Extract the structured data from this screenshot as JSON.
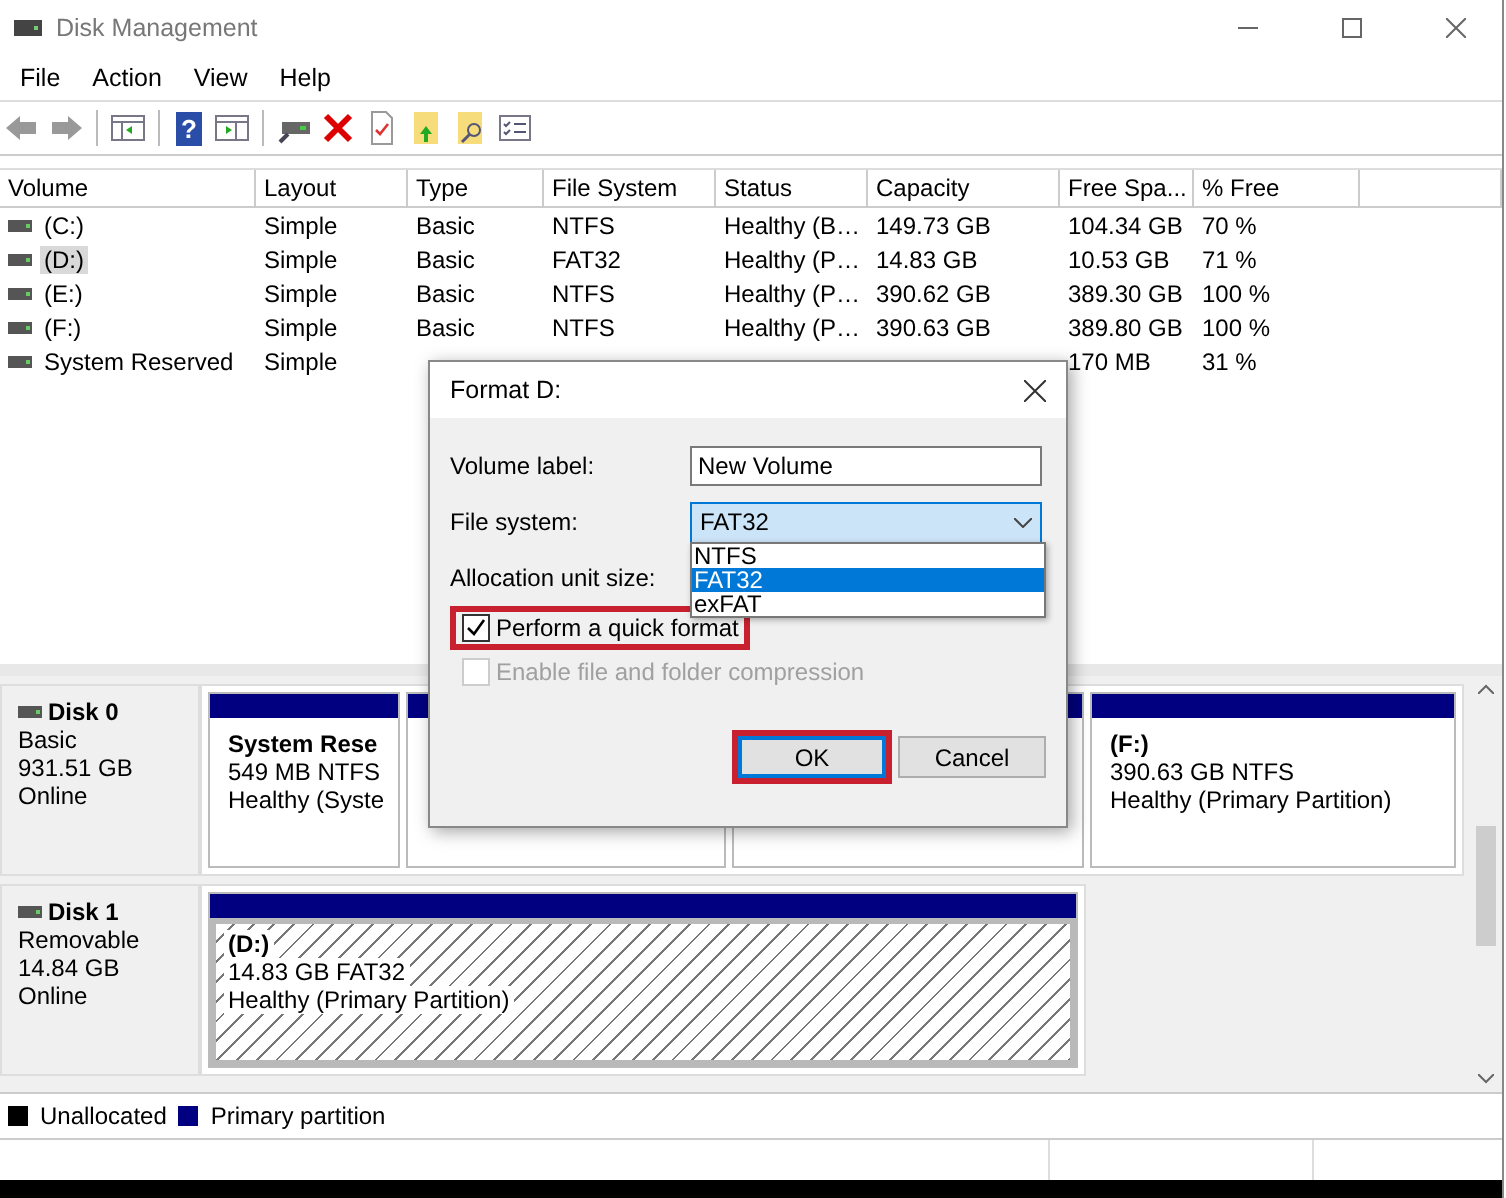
{
  "window": {
    "title": "Disk Management"
  },
  "menu": [
    "File",
    "Action",
    "View",
    "Help"
  ],
  "toolbar": {
    "help_glyph": "?"
  },
  "table": {
    "columns": [
      "Volume",
      "Layout",
      "Type",
      "File System",
      "Status",
      "Capacity",
      "Free Spa...",
      "% Free"
    ],
    "rows": [
      {
        "cells": [
          "(C:)",
          "Simple",
          "Basic",
          "NTFS",
          "Healthy (B…",
          "149.73 GB",
          "104.34 GB",
          "70 %"
        ],
        "selected": false
      },
      {
        "cells": [
          "(D:)",
          "Simple",
          "Basic",
          "FAT32",
          "Healthy (P…",
          "14.83 GB",
          "10.53 GB",
          "71 %"
        ],
        "selected": true
      },
      {
        "cells": [
          "(E:)",
          "Simple",
          "Basic",
          "NTFS",
          "Healthy (P…",
          "390.62 GB",
          "389.30 GB",
          "100 %"
        ],
        "selected": false
      },
      {
        "cells": [
          "(F:)",
          "Simple",
          "Basic",
          "NTFS",
          "Healthy (P…",
          "390.63 GB",
          "389.80 GB",
          "100 %"
        ],
        "selected": false
      },
      {
        "cells": [
          "System Reserved",
          "Simple",
          null,
          null,
          null,
          null,
          "170 MB",
          "31 %"
        ],
        "selected": false
      }
    ]
  },
  "disks": [
    {
      "name": "Disk 0",
      "lines": [
        "Basic",
        "931.51 GB",
        "Online"
      ],
      "partitions": [
        {
          "title": "System Rese",
          "lines": [
            "549 MB NTFS",
            "Healthy (Syste"
          ],
          "hatched": false
        },
        {
          "hatched": false
        },
        {
          "hatched": false
        },
        {
          "title": "(F:)",
          "lines": [
            "390.63 GB NTFS",
            "Healthy (Primary Partition)"
          ],
          "hatched": false
        }
      ]
    },
    {
      "name": "Disk 1",
      "lines": [
        "Removable",
        "14.84 GB",
        "Online"
      ],
      "partitions": [
        {
          "title": "(D:)",
          "lines": [
            "14.83 GB FAT32",
            "Healthy (Primary Partition)"
          ],
          "hatched": true
        }
      ]
    }
  ],
  "legend": [
    {
      "label": "Unallocated",
      "color": "#000000"
    },
    {
      "label": "Primary partition",
      "color": "#000080"
    }
  ],
  "dialog": {
    "title": "Format D:",
    "volume_label": {
      "label": "Volume label:",
      "value": "New Volume"
    },
    "file_system": {
      "label": "File system:",
      "value": "FAT32",
      "options": [
        {
          "label": "NTFS",
          "selected": false
        },
        {
          "label": "FAT32",
          "selected": true
        },
        {
          "label": "exFAT",
          "selected": false
        }
      ]
    },
    "allocation": {
      "label": "Allocation unit size:"
    },
    "quick_format": {
      "label": "Perform a quick format",
      "checked": true,
      "disabled": false,
      "highlighted": true
    },
    "compression": {
      "label": "Enable file and folder compression",
      "checked": false,
      "disabled": true
    },
    "buttons": [
      {
        "label": "OK",
        "default": true,
        "highlighted": true
      },
      {
        "label": "Cancel",
        "default": false
      }
    ]
  }
}
